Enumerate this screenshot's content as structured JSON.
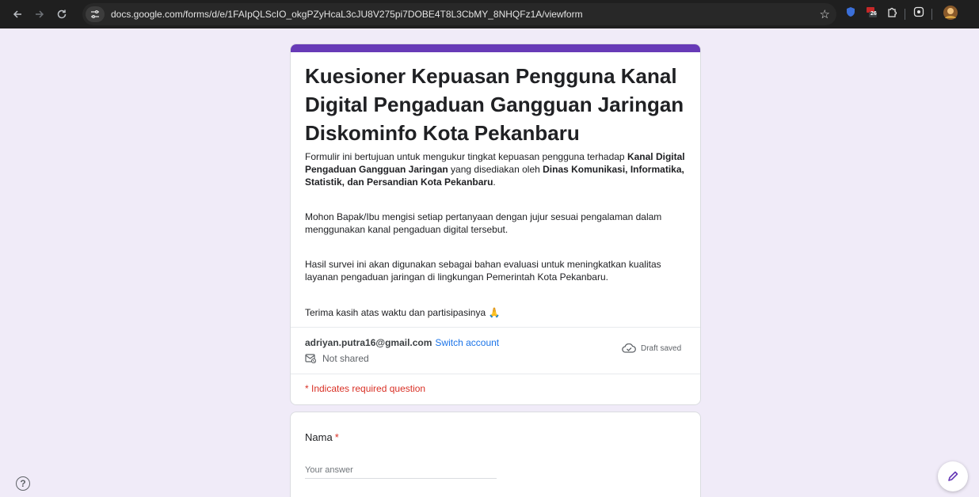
{
  "browser": {
    "url": "docs.google.com/forms/d/e/1FAIpQLScIO_okgPZyHcaL3cJU8V275pi7DOBE4T8L3CbMY_8NHQFz1A/viewform",
    "extension_badge": "26",
    "icons": {
      "back": "arrow-left-icon",
      "forward": "arrow-right-icon",
      "reload": "reload-icon",
      "site_info": "tune-icon",
      "bookmark": "star-icon",
      "extensions": "puzzle-icon",
      "lens": "lens-icon"
    }
  },
  "form": {
    "accent_color": "#673ab7",
    "title": "Kuesioner Kepuasan Pengguna Kanal Digital Pengaduan Gangguan Jaringan Diskominfo Kota Pekanbaru",
    "description": {
      "p1_a": "Formulir ini bertujuan untuk mengukur tingkat kepuasan pengguna terhadap ",
      "p1_b": "Kanal Digital Pengaduan Gangguan Jaringan",
      "p1_c": " yang disediakan oleh ",
      "p1_d": "Dinas Komunikasi, Informatika, Statistik, dan Persandian Kota Pekanbaru",
      "p1_e": ".",
      "p2": "Mohon Bapak/Ibu mengisi setiap pertanyaan dengan jujur sesuai pengalaman dalam menggunakan kanal pengaduan digital tersebut.",
      "p3": "Hasil survei ini akan digunakan sebagai bahan evaluasi untuk meningkatkan kualitas layanan pengaduan jaringan di lingkungan Pemerintah Kota Pekanbaru.",
      "p4": "Terima kasih atas waktu dan partisipasinya 🙏"
    },
    "account": {
      "email": "adriyan.putra16@gmail.com",
      "switch_label": "Switch account",
      "shared_label": "Not shared",
      "draft_label": "Draft saved"
    },
    "required_note": "* Indicates required question",
    "questions": [
      {
        "title": "Nama",
        "required_mark": "*",
        "placeholder": "Your answer"
      }
    ]
  }
}
